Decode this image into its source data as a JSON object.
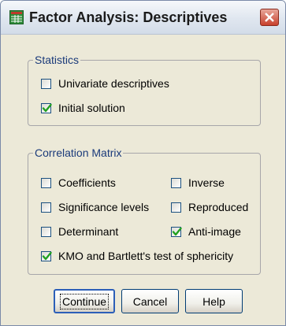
{
  "window": {
    "title": "Factor Analysis: Descriptives"
  },
  "statistics": {
    "legend": "Statistics",
    "items": [
      {
        "label": "Univariate descriptives",
        "checked": false
      },
      {
        "label": "Initial solution",
        "checked": true
      }
    ]
  },
  "correlation_matrix": {
    "legend": "Correlation Matrix",
    "items": [
      {
        "label": "Coefficients",
        "checked": false
      },
      {
        "label": "Inverse",
        "checked": false
      },
      {
        "label": "Significance levels",
        "checked": false
      },
      {
        "label": "Reproduced",
        "checked": false
      },
      {
        "label": "Determinant",
        "checked": false
      },
      {
        "label": "Anti-image",
        "checked": true
      },
      {
        "label": "KMO and Bartlett's test of sphericity",
        "checked": true
      }
    ]
  },
  "buttons": {
    "continue": "Continue",
    "cancel": "Cancel",
    "help": "Help"
  },
  "colors": {
    "dialog_bg": "#ece9d8",
    "legend_text": "#1a3a7a",
    "checkmark": "#21a121",
    "close_button": "#c8402c"
  }
}
